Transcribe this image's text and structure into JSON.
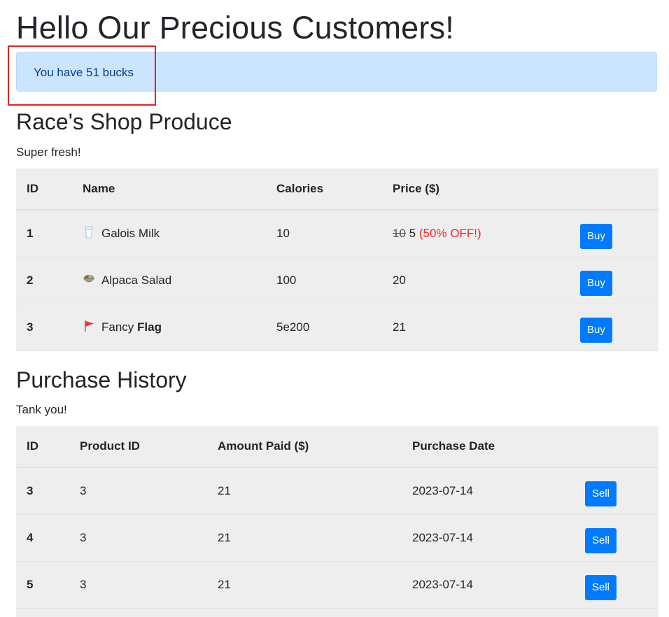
{
  "page": {
    "title": "Hello Our Precious Customers!",
    "balance_text": "You have 51 bucks"
  },
  "shop": {
    "heading": "Race's Shop Produce",
    "subtitle": "Super fresh!",
    "columns": [
      "ID",
      "Name",
      "Calories",
      "Price ($)"
    ],
    "items": [
      {
        "id": "1",
        "icon": "milk-glass-icon",
        "name": "Galois Milk",
        "name_bold": "",
        "calories": "10",
        "old_price": "10",
        "price": "5",
        "discount": "(50% OFF!)",
        "button": "Buy"
      },
      {
        "id": "2",
        "icon": "salad-bowl-icon",
        "name": "Alpaca Salad",
        "name_bold": "",
        "calories": "100",
        "old_price": "",
        "price": "20",
        "discount": "",
        "button": "Buy"
      },
      {
        "id": "3",
        "icon": "red-flag-icon",
        "name": "Fancy ",
        "name_bold": "Flag",
        "calories": "5e200",
        "old_price": "",
        "price": "21",
        "discount": "",
        "button": "Buy"
      }
    ]
  },
  "history": {
    "heading": "Purchase History",
    "subtitle": "Tank you!",
    "columns": [
      "ID",
      "Product ID",
      "Amount Paid ($)",
      "Purchase Date"
    ],
    "rows": [
      {
        "id": "3",
        "product_id": "3",
        "amount": "21",
        "date": "2023-07-14",
        "button": "Sell"
      },
      {
        "id": "4",
        "product_id": "3",
        "amount": "21",
        "date": "2023-07-14",
        "button": "Sell"
      },
      {
        "id": "5",
        "product_id": "3",
        "amount": "21",
        "date": "2023-07-14",
        "button": "Sell"
      }
    ]
  },
  "colors": {
    "alert_bg": "#cce5ff",
    "alert_text": "#004085",
    "button": "#007bff",
    "discount": "#ff1f1f",
    "highlight": "#e8201c"
  }
}
